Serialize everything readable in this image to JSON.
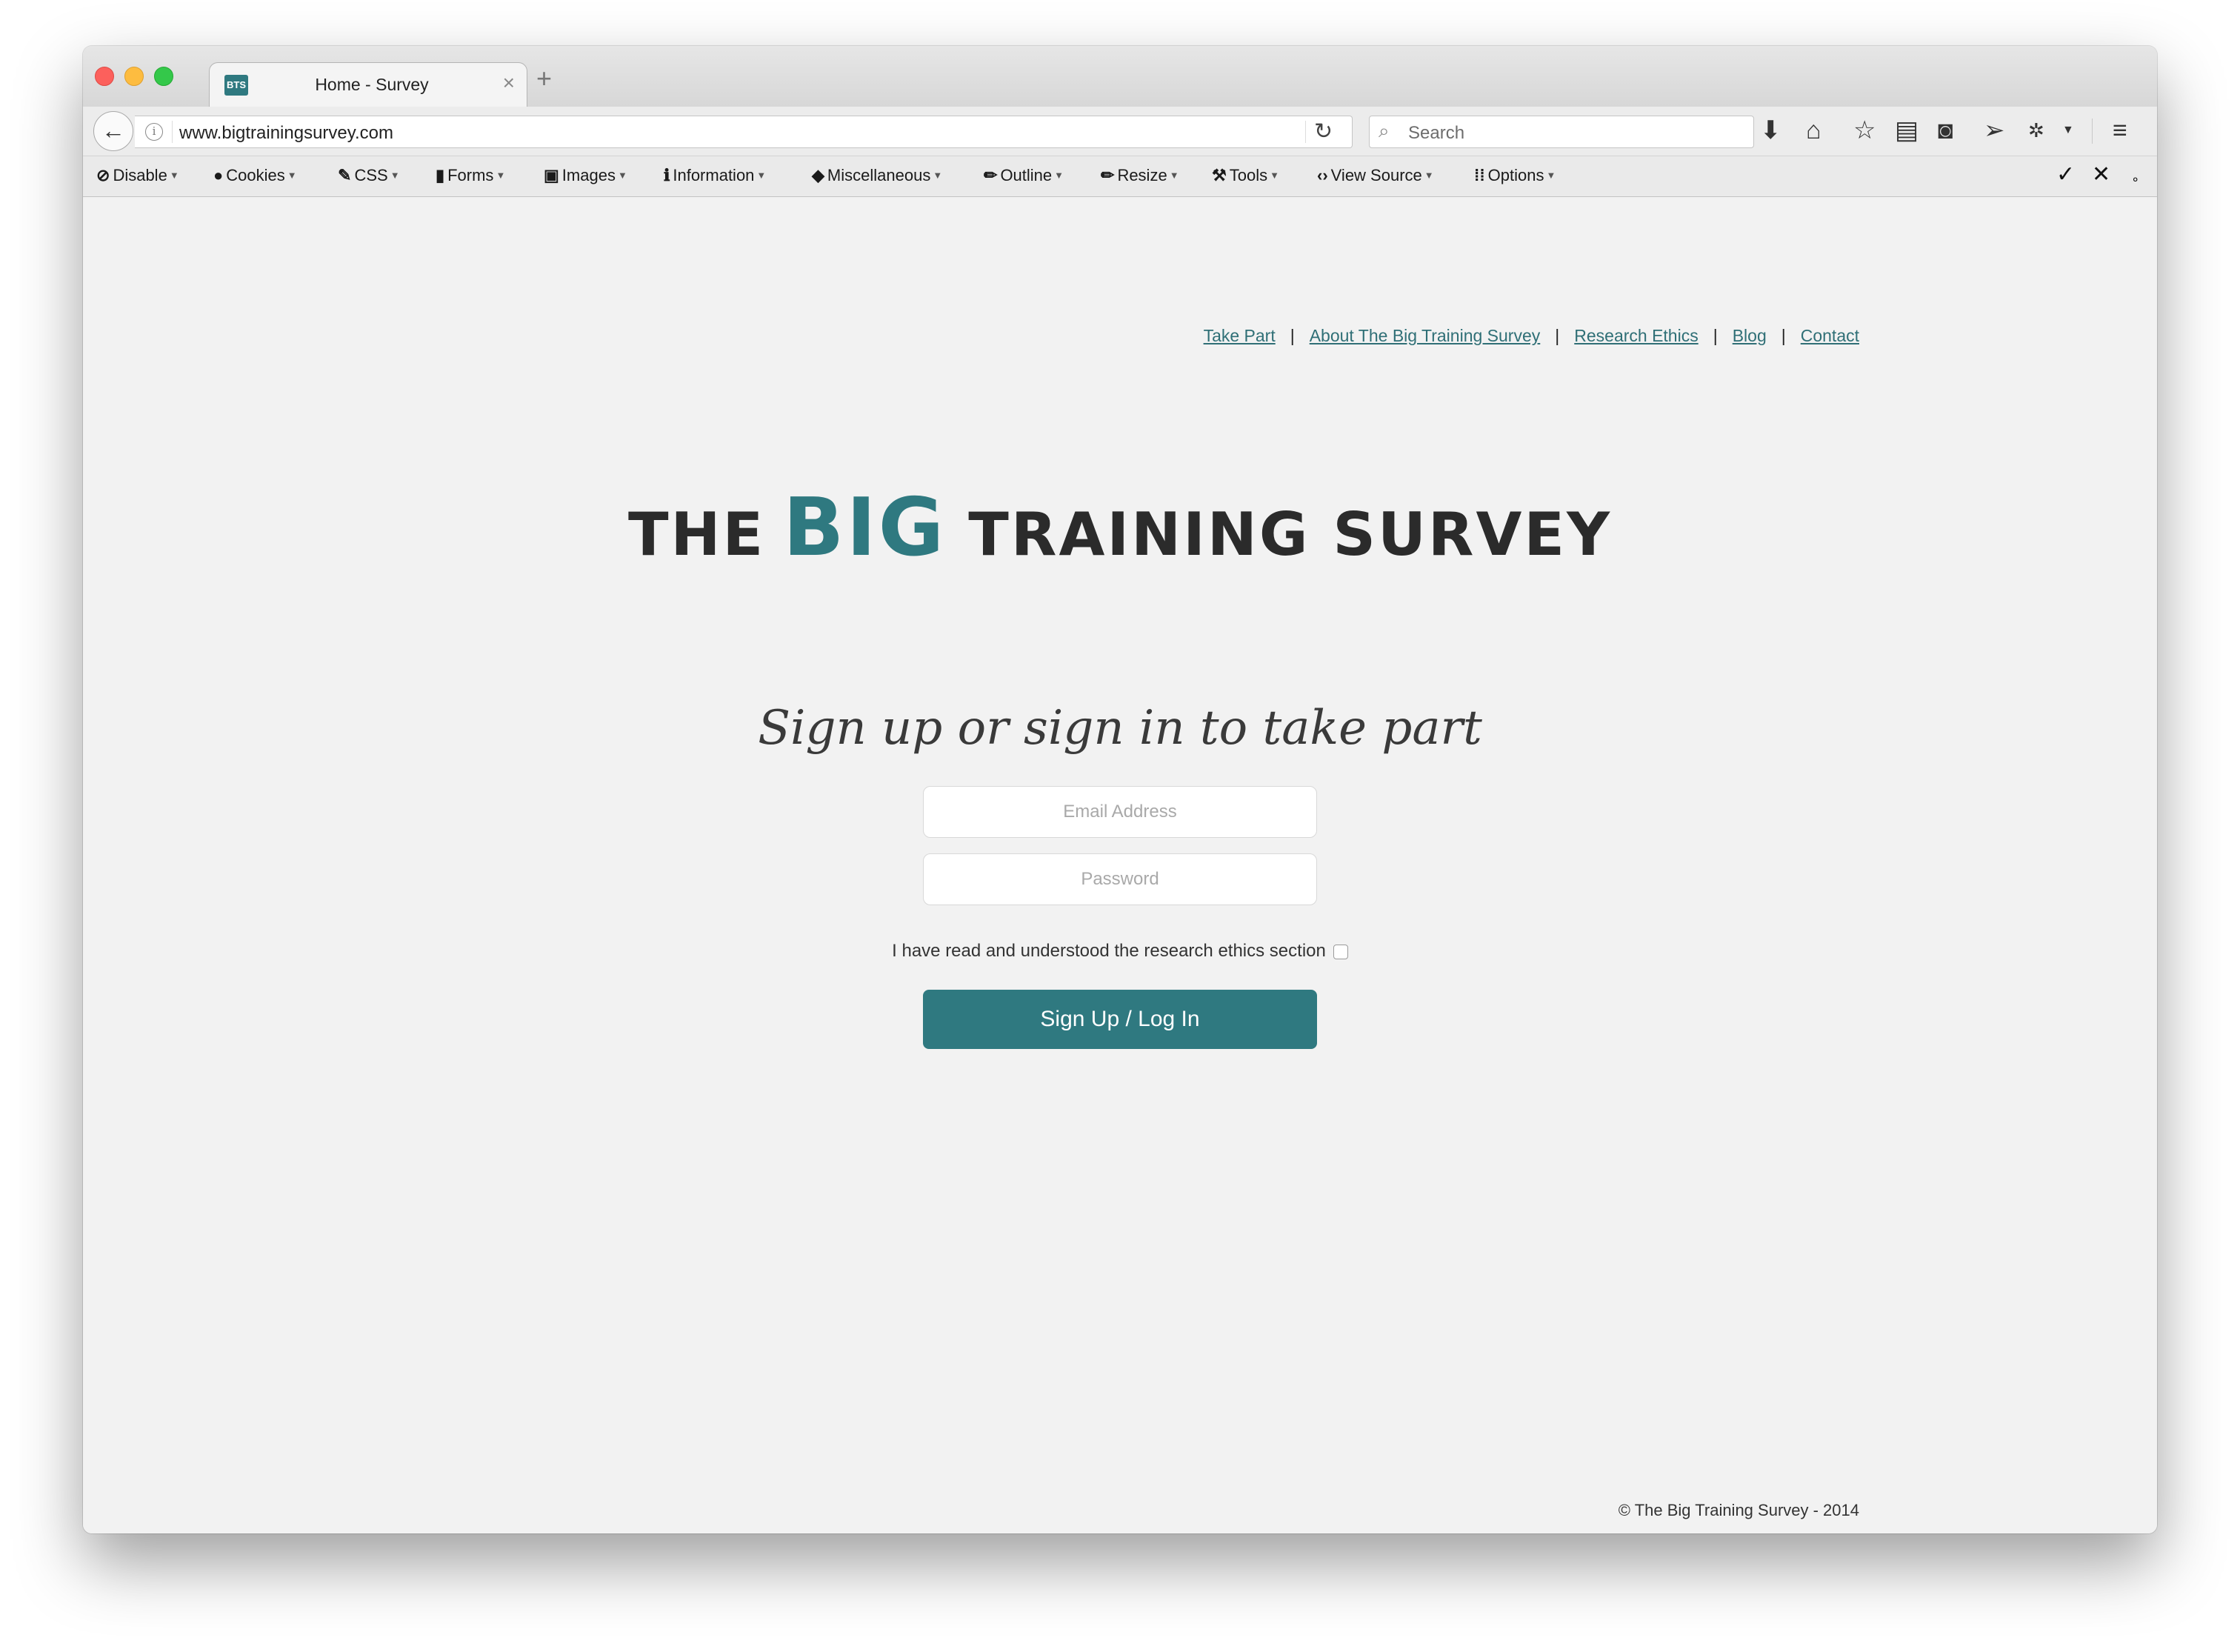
{
  "browser": {
    "tab_title": "Home - Survey",
    "favicon_text": "BTS",
    "url": "www.bigtrainingsurvey.com",
    "search_placeholder": "Search"
  },
  "devtoolbar": {
    "items": [
      "Disable",
      "Cookies",
      "CSS",
      "Forms",
      "Images",
      "Information",
      "Miscellaneous",
      "Outline",
      "Resize",
      "Tools",
      "View Source",
      "Options"
    ]
  },
  "site": {
    "nav": [
      "Take Part",
      "About The Big Training Survey",
      "Research Ethics",
      "Blog",
      "Contact"
    ],
    "logo": {
      "part1": "THE",
      "part2": "BIG",
      "part3": "TRAINING SURVEY"
    },
    "tagline": "Sign up or sign in to take part",
    "email_placeholder": "Email Address",
    "password_placeholder": "Password",
    "ethics_label": "I have read and understood the research ethics section",
    "submit_label": "Sign Up / Log In",
    "footer": "© The Big Training Survey - 2014"
  },
  "colors": {
    "accent": "#2f7980",
    "link": "#2f6f76"
  }
}
